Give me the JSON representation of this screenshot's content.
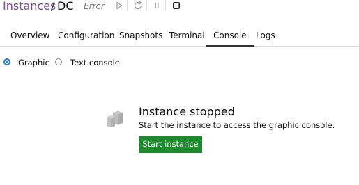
{
  "breadcrumb": {
    "root": "Instances",
    "separator": "/",
    "instance_name": "DC"
  },
  "instance_status": "Error",
  "controls": [
    {
      "name": "start",
      "icon": "play-icon"
    },
    {
      "name": "restart",
      "icon": "restart-icon"
    },
    {
      "name": "freeze",
      "icon": "pause-icon"
    },
    {
      "name": "stop",
      "icon": "stop-icon"
    }
  ],
  "tabs": [
    {
      "label": "Overview",
      "active": false
    },
    {
      "label": "Configuration",
      "active": false
    },
    {
      "label": "Snapshots",
      "active": false
    },
    {
      "label": "Terminal",
      "active": false
    },
    {
      "label": "Console",
      "active": true
    },
    {
      "label": "Logs",
      "active": false
    }
  ],
  "console_mode": {
    "options": [
      {
        "label": "Graphic",
        "selected": true
      },
      {
        "label": "Text console",
        "selected": false
      }
    ]
  },
  "empty_state": {
    "icon": "cubes-icon",
    "title": "Instance stopped",
    "description": "Start the instance to access the graphic console.",
    "button_label": "Start instance"
  },
  "colors": {
    "breadcrumb_link": "#7b4aa3",
    "radio_selected": "#2f7fd0",
    "primary_button": "#1e8a2e"
  }
}
